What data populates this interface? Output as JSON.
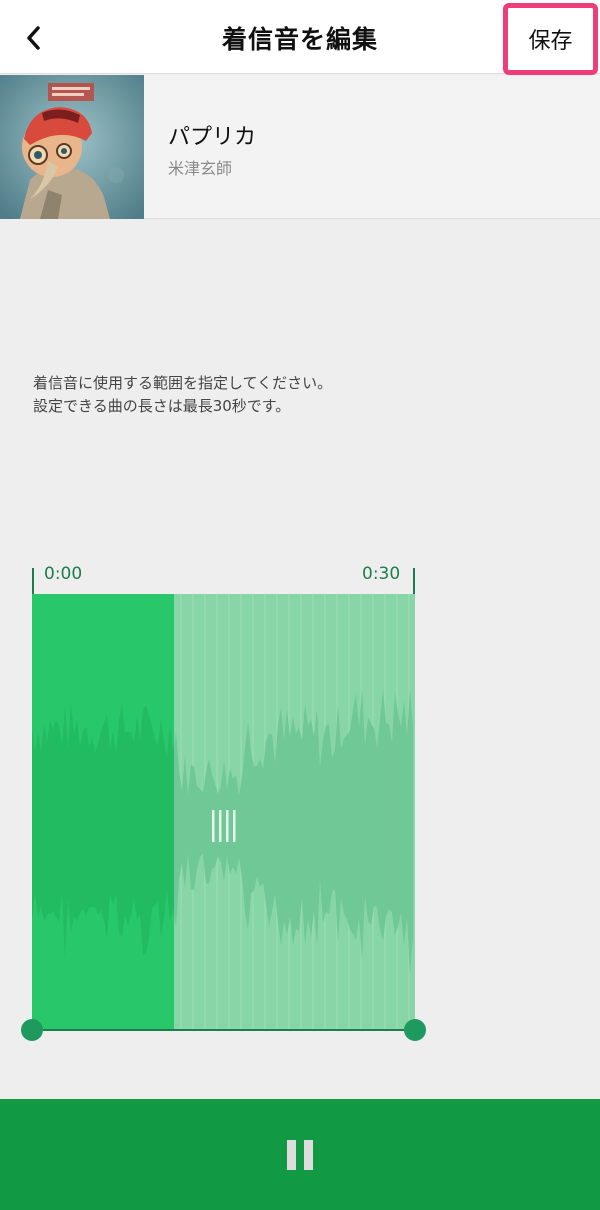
{
  "header": {
    "title": "着信音を編集",
    "save_label": "保存"
  },
  "song": {
    "title": "パプリカ",
    "artist": "米津玄師"
  },
  "instructions": {
    "line1": "着信音に使用する範囲を指定してください。",
    "line2": "設定できる曲の長さは最長30秒です。"
  },
  "editor": {
    "start_time": "0:00",
    "end_time": "0:30",
    "playback_progress": 0.37
  },
  "player": {
    "state": "playing",
    "control_icon": "pause-icon"
  },
  "colors": {
    "accent_green": "#119944",
    "wave_played": "#28c76a",
    "wave_unplayed": "#88d6a6",
    "highlight": "#ee3d78"
  }
}
